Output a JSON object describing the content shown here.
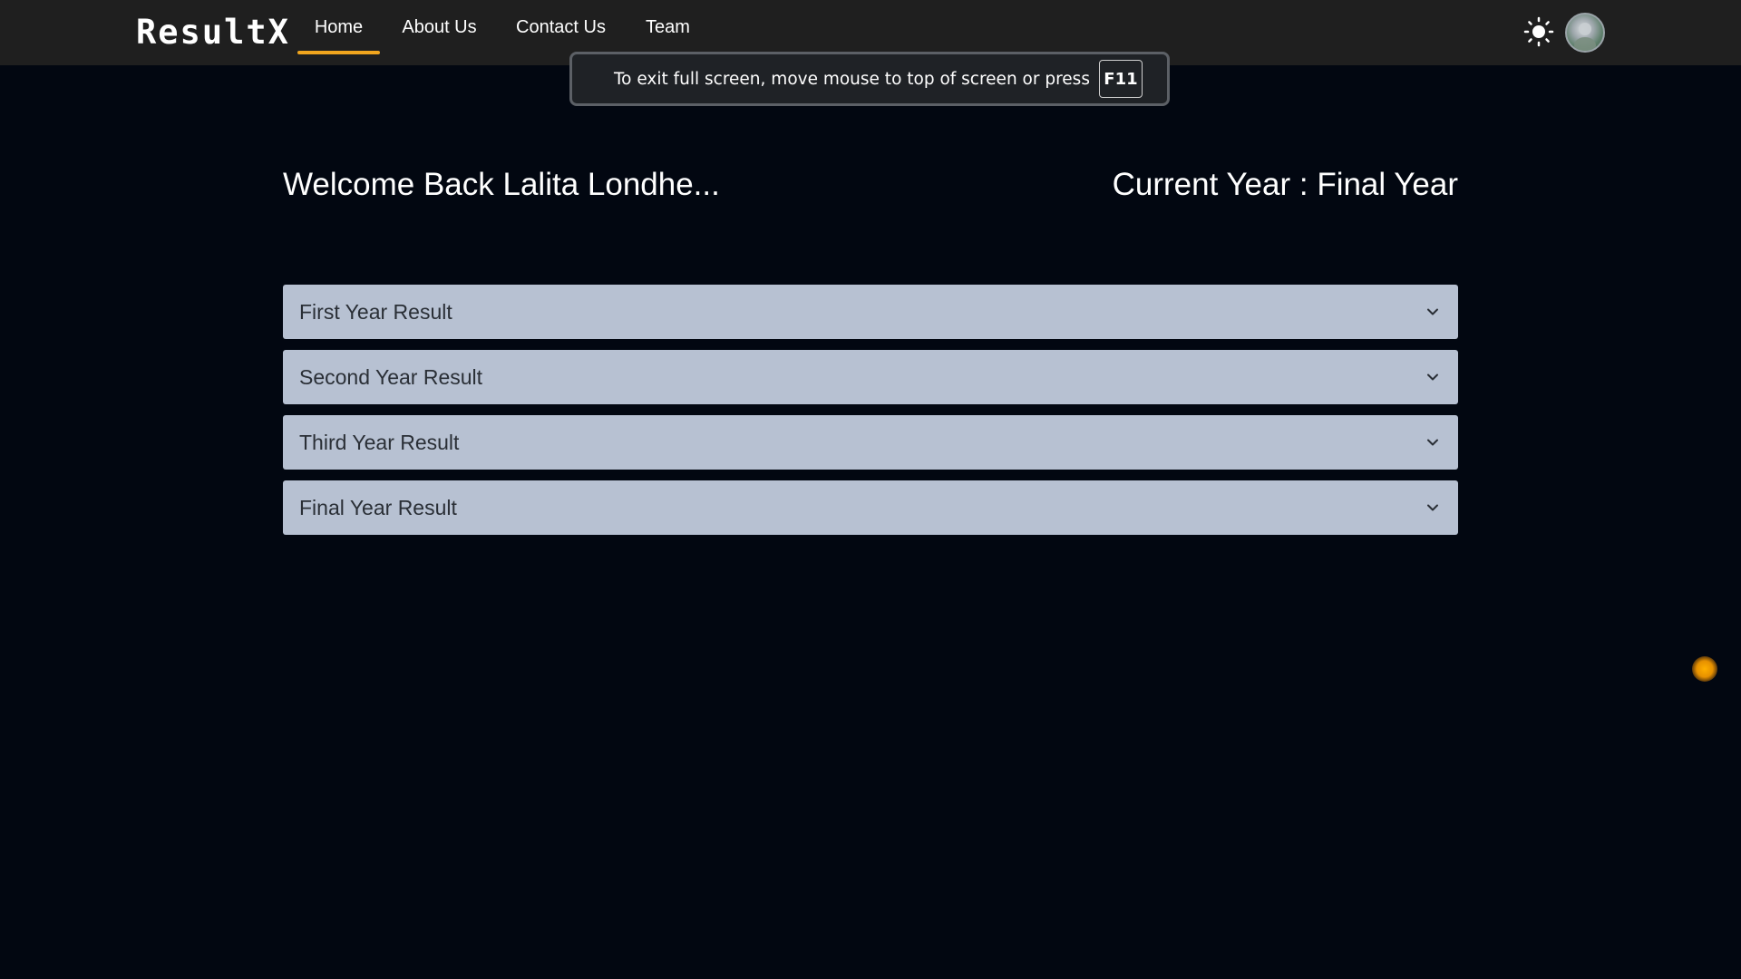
{
  "navbar": {
    "logo": "ResultX",
    "links": [
      {
        "label": "Home",
        "active": true
      },
      {
        "label": "About Us",
        "active": false
      },
      {
        "label": "Contact Us",
        "active": false
      },
      {
        "label": "Team",
        "active": false
      }
    ],
    "theme_icon": "sun-icon",
    "avatar_icon": "user-avatar"
  },
  "fullscreen_toast": {
    "message": "To exit full screen, move mouse to top of screen or press",
    "key": "F11"
  },
  "main": {
    "welcome": "Welcome Back Lalita Londhe...",
    "current_year": "Current Year : Final Year",
    "accordion": [
      {
        "label": "First Year Result",
        "icon": "chevron-down-icon"
      },
      {
        "label": "Second Year Result",
        "icon": "chevron-down-icon"
      },
      {
        "label": "Third Year Result",
        "icon": "chevron-down-icon"
      },
      {
        "label": "Final Year Result",
        "icon": "chevron-down-icon"
      }
    ]
  },
  "colors": {
    "background": "#020711",
    "navbar": "#1f1f1f",
    "accent": "#f0a51e",
    "accordion_bg": "#b7c1d2",
    "accordion_text": "#2a2f36"
  }
}
